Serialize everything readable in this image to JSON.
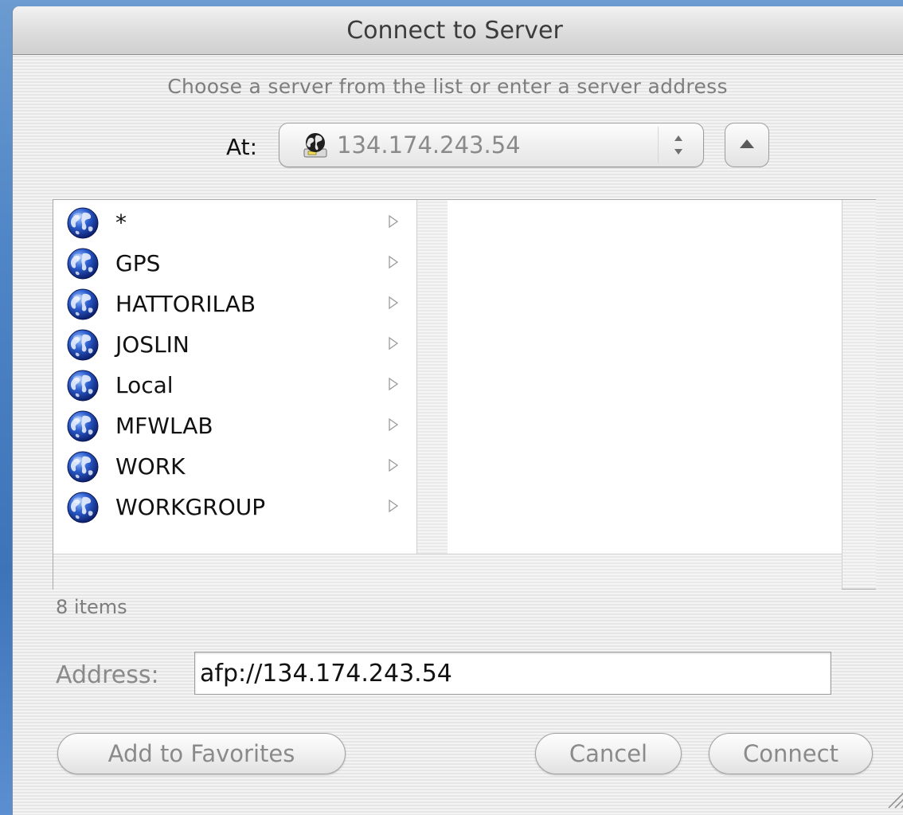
{
  "window": {
    "title": "Connect to Server"
  },
  "prompt": "Choose a server from the list or enter a server address",
  "at": {
    "label": "At:",
    "value": "134.174.243.54",
    "icon": "server-globe-icon"
  },
  "browser": {
    "items": [
      {
        "label": "*",
        "icon": "globe-icon"
      },
      {
        "label": "GPS",
        "icon": "globe-icon"
      },
      {
        "label": "HATTORILAB",
        "icon": "globe-icon"
      },
      {
        "label": "JOSLIN",
        "icon": "globe-icon"
      },
      {
        "label": "Local",
        "icon": "globe-icon"
      },
      {
        "label": "MFWLAB",
        "icon": "globe-icon"
      },
      {
        "label": "WORK",
        "icon": "globe-icon"
      },
      {
        "label": "WORKGROUP",
        "icon": "globe-icon"
      }
    ],
    "count_label": "8 items"
  },
  "address": {
    "label": "Address:",
    "value": "afp://134.174.243.54"
  },
  "buttons": {
    "add_to_favorites": "Add to Favorites",
    "cancel": "Cancel",
    "connect": "Connect"
  }
}
